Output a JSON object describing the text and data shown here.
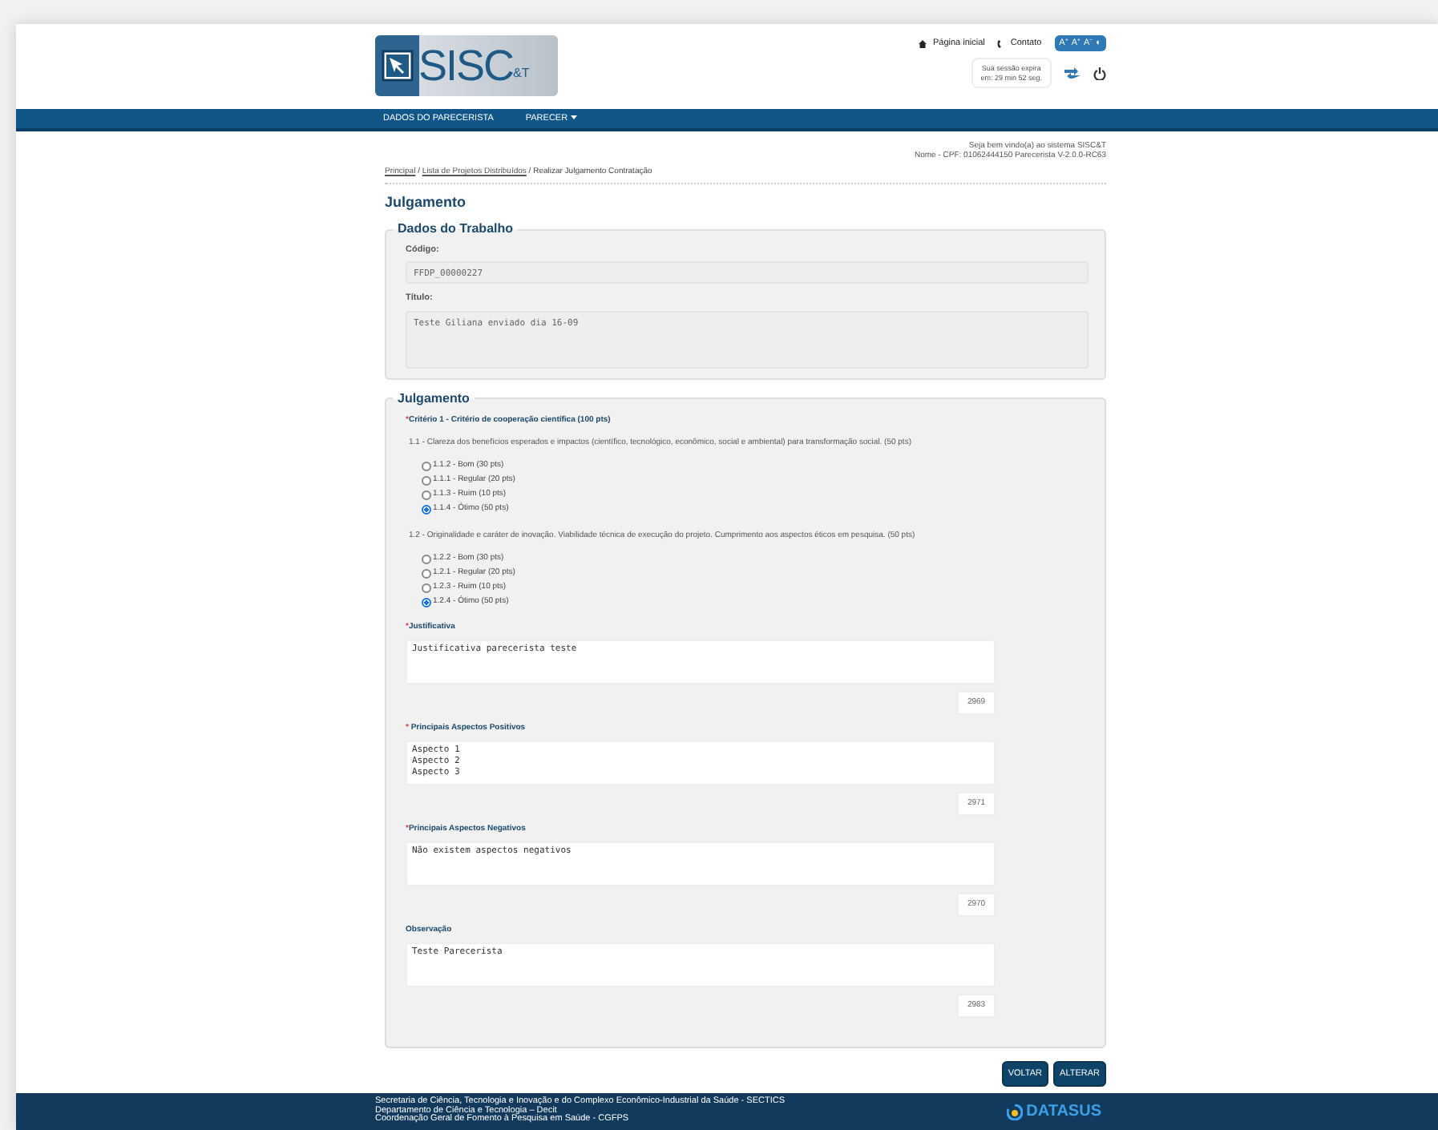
{
  "header": {
    "logo": "SISC",
    "logo_suffix": "&T",
    "links": [
      "Página inicial",
      "Contato"
    ],
    "font_buttons": [
      "A⁺",
      "A⁺",
      "A⁻",
      "◐"
    ],
    "session": [
      "Sua sessão expira",
      "em: 29 min 52 seg."
    ]
  },
  "marks": {
    "required": "*",
    "separator": " / "
  },
  "nav": [
    {
      "label": "DADOS DO PARECERISTA",
      "kind": "link"
    },
    {
      "label": "PARECER",
      "kind": "dropdown"
    }
  ],
  "welcome": [
    "Seja bem vindo(a) ao sistema SISC&T",
    "Nome - CPF: 01062444150 Parecerista V-2.0.0-RC63"
  ],
  "breadcrumb": [
    {
      "label": "Principal",
      "kind": "link"
    },
    {
      "label": "Lista de Projetos Distribuídos",
      "kind": "link"
    },
    {
      "label": "Realizar Julgamento Contratação",
      "kind": "current"
    }
  ],
  "page_title": "Julgamento",
  "dados": {
    "legend": "Dados do Trabalho",
    "fields": [
      {
        "label": "Código:",
        "value": "FFDP_00000227",
        "kind": "short"
      },
      {
        "label": "Título:",
        "value": "Teste Giliana enviado dia 16-09",
        "kind": "tall"
      }
    ]
  },
  "julgamento": {
    "legend": "Julgamento",
    "criterion": "Critério 1 - Critério de cooperação científica (100 pts)",
    "required": true,
    "questions": [
      {
        "text": "1.1 - Clareza dos benefícios esperados e impactos (científico, tecnológico, econômico, social e ambiental) para transformação social. (50 pts)",
        "options": [
          {
            "label": "1.1.2 - Bom (30 pts)",
            "selected": false
          },
          {
            "label": "1.1.1 - Regular (20 pts)",
            "selected": false
          },
          {
            "label": "1.1.3 - Ruim (10 pts)",
            "selected": false
          },
          {
            "label": "1.1.4 - Ótimo (50 pts)",
            "selected": true
          }
        ]
      },
      {
        "text": "1.2 - Originalidade e caráter de inovação. Viabilidade técnica de execução do projeto. Cumprimento aos aspectos éticos em pesquisa. (50 pts)",
        "options": [
          {
            "label": "1.2.2 - Bom (30 pts)",
            "selected": false
          },
          {
            "label": "1.2.1 - Regular (20 pts)",
            "selected": false
          },
          {
            "label": "1.2.3 - Ruim (10 pts)",
            "selected": false
          },
          {
            "label": "1.2.4 - Ótimo (50 pts)",
            "selected": true
          }
        ]
      }
    ],
    "texts": [
      {
        "label": "Justificativa",
        "required": true,
        "value": "Justificativa parecerista teste",
        "counter": "2969"
      },
      {
        "label": " Principais Aspectos Positivos",
        "required": true,
        "value": "Aspecto 1\nAspecto 2\nAspecto 3",
        "counter": "2971"
      },
      {
        "label": "Principais Aspectos Negativos",
        "required": true,
        "value": "Não existem aspectos negativos",
        "counter": "2970"
      },
      {
        "label": "Observação",
        "required": false,
        "value": "Teste Parecerista",
        "counter": "2983"
      }
    ]
  },
  "buttons": [
    "VOLTAR",
    "ALTERAR"
  ],
  "footer": {
    "lines": [
      "Secretaria de Ciência, Tecnologia e Inovação e do Complexo Econômico-Industrial da Saúde - SECTICS",
      "Departamento de Ciência e Tecnologia – Decit",
      "Coordenação Geral de Fomento à Pesquisa em Saúde - CGFPS"
    ],
    "brand": "DATASUS"
  }
}
